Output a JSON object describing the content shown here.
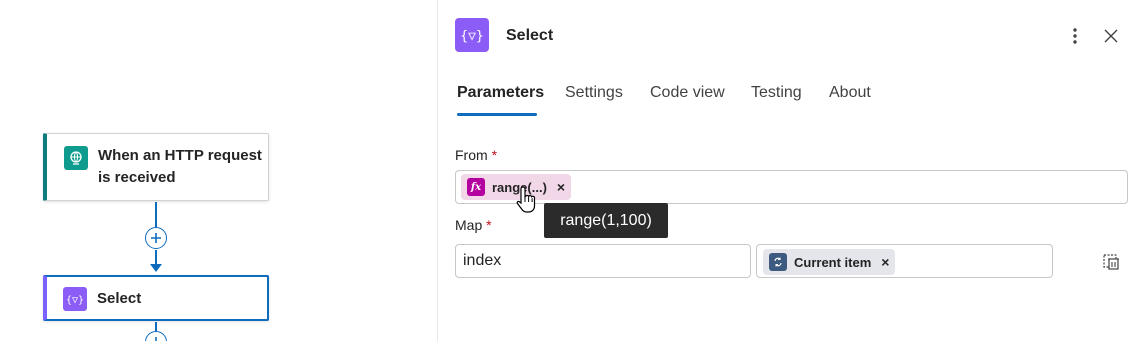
{
  "canvas": {
    "trigger_node": {
      "title": "When an HTTP request is received",
      "icon": "globe-icon",
      "color": "#0f9b8e"
    },
    "select_node": {
      "title": "Select",
      "icon": "select-braces-icon",
      "color": "#8b5cf6"
    }
  },
  "panel": {
    "title": "Select",
    "icon": "select-braces-icon",
    "tabs": [
      {
        "label": "Parameters",
        "active": true
      },
      {
        "label": "Settings",
        "active": false
      },
      {
        "label": "Code view",
        "active": false
      },
      {
        "label": "Testing",
        "active": false
      },
      {
        "label": "About",
        "active": false
      }
    ],
    "from": {
      "label": "From",
      "required_mark": "*",
      "token": {
        "label": "range(...)",
        "icon": "function-icon",
        "color": "#b4009e",
        "remove": "×"
      },
      "tooltip": "range(1,100)"
    },
    "map": {
      "label": "Map",
      "required_mark": "*",
      "key_value": "index",
      "value_token": {
        "label": "Current item",
        "icon": "loop-icon",
        "color": "#3d5a80",
        "remove": "×"
      }
    }
  }
}
